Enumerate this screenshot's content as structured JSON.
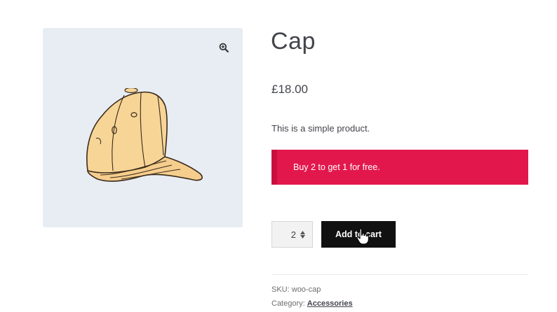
{
  "product": {
    "title": "Cap",
    "price": "£18.00",
    "description": "This is a simple product.",
    "notice": "Buy 2 to get 1 for free.",
    "quantity": "2",
    "add_to_cart_label": "Add to cart",
    "sku_label": "SKU:",
    "sku_value": "woo-cap",
    "category_label": "Category:",
    "category_value": "Accessories"
  },
  "gallery": {
    "image": "cap-image",
    "zoom_icon": "zoom-icon"
  },
  "colors": {
    "notice_bg": "#e2184d",
    "button_bg": "#111111",
    "gallery_bg": "#e8edf3"
  }
}
